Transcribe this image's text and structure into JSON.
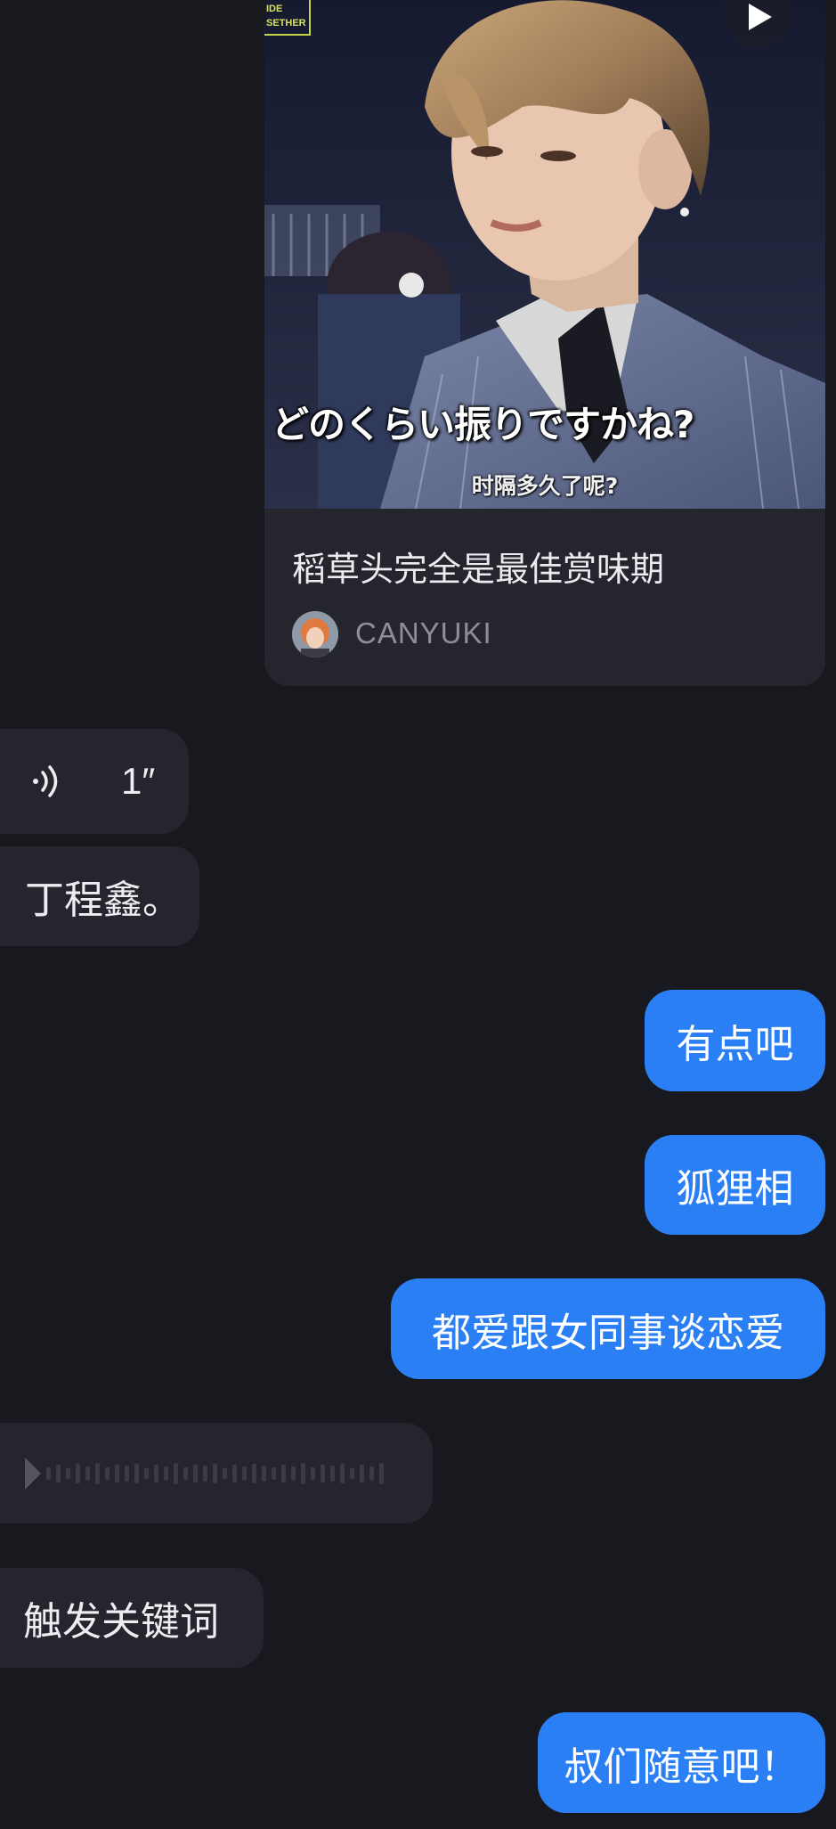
{
  "video_card": {
    "badge_text": "ⁱᴰᴱ\nSETHER",
    "subtitle_jp": "どのくらい振りですかね?",
    "subtitle_cn": "时隔多久了呢?",
    "title": "稻草头完全是最佳赏味期",
    "author": "CANYUKI",
    "play_icon": "play-icon"
  },
  "messages": {
    "voice_duration": "1″",
    "voice_icon": "voice-wave-icon",
    "dingchengxin": "丁程鑫。",
    "youdianba": "有点吧",
    "hulixiang": "狐狸相",
    "duai": "都爱跟女同事谈恋爱",
    "chufa": "触发关键词",
    "shumen": "叔们随意吧！"
  },
  "colors": {
    "background": "#18181f",
    "incoming_bubble": "#25252d",
    "outgoing_bubble": "#2b7ff5",
    "text_light": "#ededf2"
  }
}
